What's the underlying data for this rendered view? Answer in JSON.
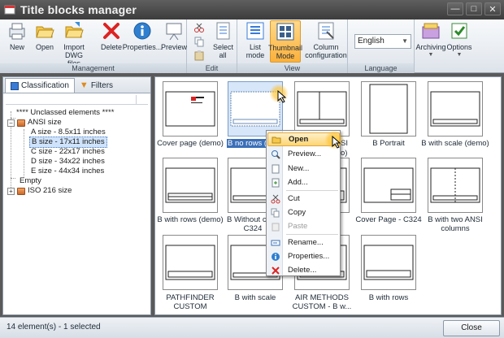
{
  "window": {
    "title": "Title blocks manager",
    "controls": [
      "—",
      "□",
      "✕"
    ]
  },
  "ribbon": {
    "groups": [
      {
        "label": "Management",
        "buttons": [
          "New",
          "Open",
          "Import DWG files",
          "Delete",
          "Properties...",
          "Preview"
        ]
      },
      {
        "label": "Edit",
        "buttons": [
          "Select all"
        ]
      },
      {
        "label": "View",
        "buttons": [
          "List mode",
          "Thumbnail Mode",
          "Column configuration"
        ]
      },
      {
        "label": "Language",
        "selected": "English"
      },
      {
        "label": "",
        "buttons": [
          "Archiving",
          "Options"
        ]
      }
    ],
    "new_label": "New",
    "open_label": "Open",
    "import_label": "Import DWG files",
    "delete_label": "Delete",
    "properties_label": "Properties...",
    "preview_label": "Preview",
    "selectall_label": "Select all",
    "listmode_label": "List mode",
    "thumbmode_label": "Thumbnail Mode",
    "colconfig_label": "Column configuration",
    "language_value": "English",
    "archiving_label": "Archiving",
    "options_label": "Options",
    "group_management": "Management",
    "group_edit": "Edit",
    "group_view": "View",
    "group_language": "Language"
  },
  "left_panel": {
    "tabs": [
      "Classification",
      "Filters"
    ],
    "tree": [
      "**** Unclassed elements ****",
      "ANSI size",
      "A size - 8.5x11 inches",
      "B size - 17x11 inches",
      "C size - 22x17 inches",
      "D size - 34x22 inches",
      "E size - 44x34 inches",
      "Empty",
      "ISO 216 size"
    ],
    "selected_item": "B size - 17x11 inches"
  },
  "thumbnails": {
    "items": [
      "Cover page (demo)",
      "B no rows (d",
      "SI",
      "B Portrait",
      "B with scale (demo)",
      "B with rows (demo)",
      "B Without co",
      "C324",
      "Cover Page - C324",
      "B with two ANSI columns",
      "PATHFINDER CUSTOM",
      "B with scale",
      "AIR METHODS CUSTOM - B w...",
      "B with rows"
    ],
    "partial_second": "o)"
  },
  "context_menu": {
    "items": [
      "Open",
      "Preview...",
      "New...",
      "Add...",
      "Cut",
      "Copy",
      "Paste",
      "Rename...",
      "Properties...",
      "Delete..."
    ],
    "highlighted": "Open",
    "disabled": [
      "Paste"
    ]
  },
  "status": {
    "text": "14 element(s) - 1 selected",
    "close_label": "Close"
  },
  "colors": {
    "accent": "#fbb03b",
    "selection": "#cfe3fb",
    "titlebar": "#3c3c3c"
  }
}
